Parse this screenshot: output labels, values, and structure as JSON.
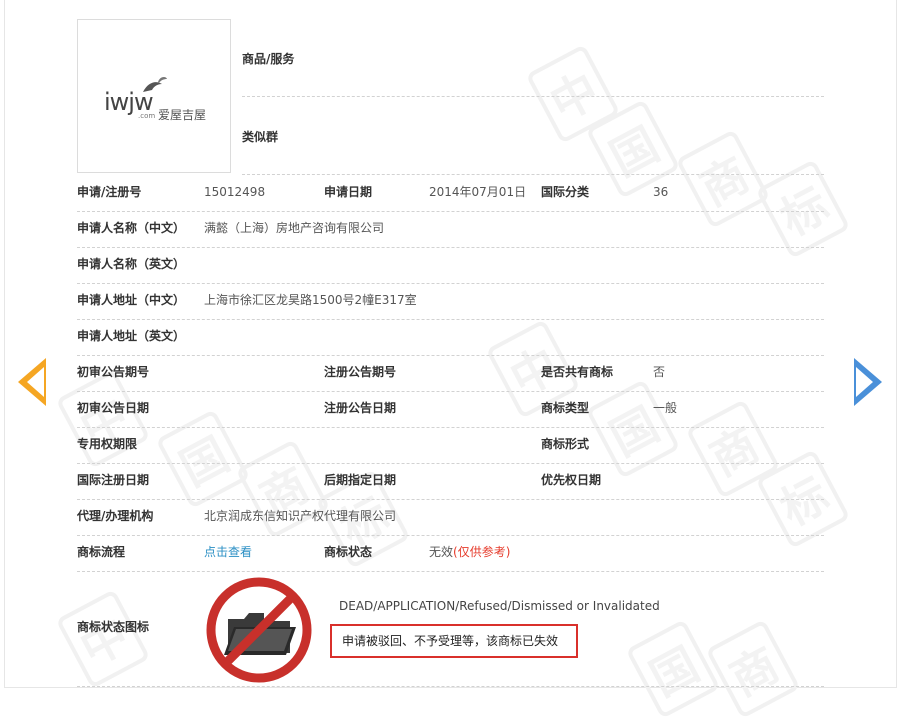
{
  "logo": {
    "latin": "iwjw",
    "com": ".com",
    "cn": "爱屋吉屋"
  },
  "watermark": [
    "中",
    "国",
    "商",
    "标"
  ],
  "top": {
    "goods_services_label": "商品/服务",
    "similar_group_label": "类似群"
  },
  "rows": {
    "r1": {
      "reg_no_label": "申请/注册号",
      "reg_no": "15012498",
      "apply_date_label": "申请日期",
      "apply_date": "2014年07月01日",
      "intl_class_label": "国际分类",
      "intl_class": "36"
    },
    "r2": {
      "label": "申请人名称（中文）",
      "value": "满懿（上海）房地产咨询有限公司"
    },
    "r3": {
      "label": "申请人名称（英文）",
      "value": ""
    },
    "r4": {
      "label": "申请人地址（中文）",
      "value": "上海市徐汇区龙昊路1500号2幢E317室"
    },
    "r5": {
      "label": "申请人地址（英文）",
      "value": ""
    },
    "r6": {
      "prelim_no_label": "初审公告期号",
      "reg_notice_no_label": "注册公告期号",
      "shared_label": "是否共有商标",
      "shared": "否"
    },
    "r7": {
      "prelim_date_label": "初审公告日期",
      "reg_notice_date_label": "注册公告日期",
      "tm_type_label": "商标类型",
      "tm_type": "一般"
    },
    "r8": {
      "exclusive_period_label": "专用权期限",
      "tm_form_label": "商标形式"
    },
    "r9": {
      "intl_reg_date_label": "国际注册日期",
      "later_date_label": "后期指定日期",
      "priority_date_label": "优先权日期"
    },
    "r10": {
      "agent_label": "代理/办理机构",
      "agent": "北京润成东信知识产权代理有限公司"
    },
    "r11": {
      "flow_label": "商标流程",
      "flow_link": "点击查看",
      "status_label": "商标状态",
      "status": "无效",
      "status_note": "(仅供参考)"
    }
  },
  "status_icon_row": {
    "label": "商标状态图标",
    "en": "DEAD/APPLICATION/Refused/Dismissed or Invalidated",
    "cn": "申请被驳回、不予受理等，该商标已失效"
  },
  "colors": {
    "prev_arrow": "#f5a623",
    "next_arrow": "#4a90d9",
    "link": "#2b8fc4",
    "alert_red": "#d9302b"
  },
  "nav": {
    "prev": "chevron-left-icon",
    "next": "chevron-right-icon"
  }
}
